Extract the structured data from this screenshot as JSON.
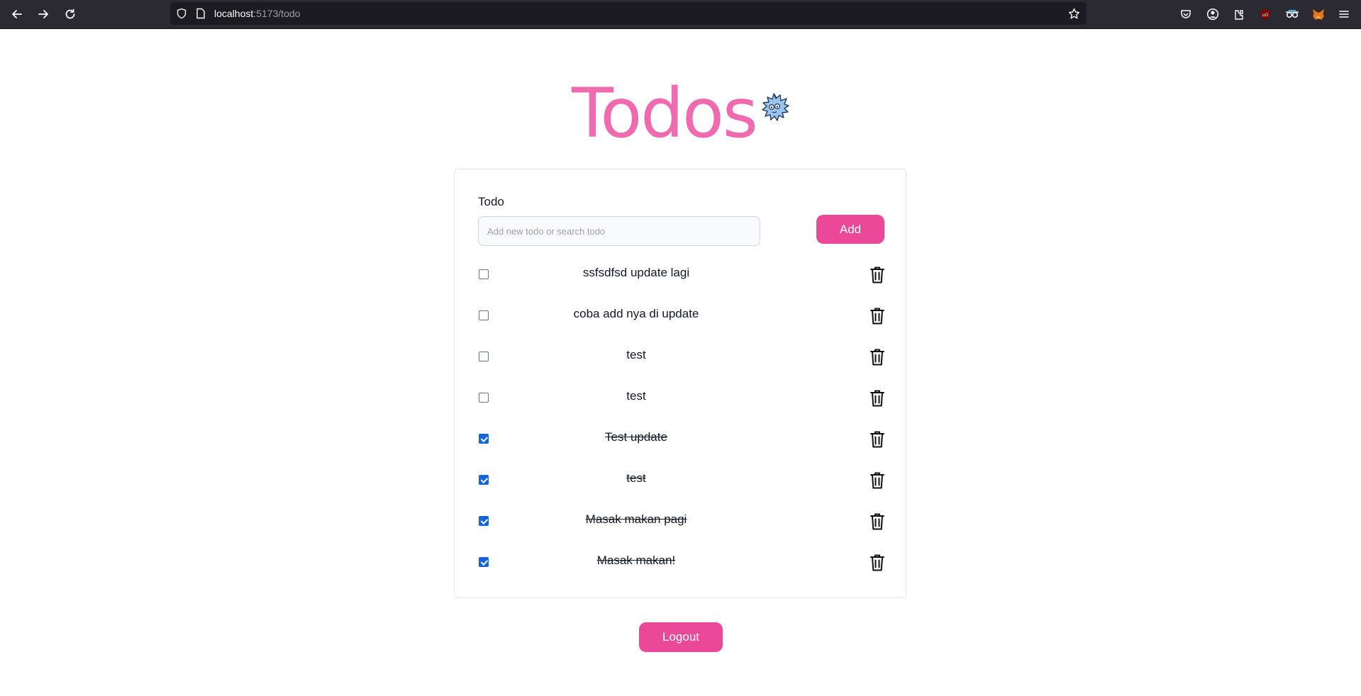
{
  "browser": {
    "url_host": "localhost",
    "url_path": ":5173/todo",
    "icons": [
      "back-icon",
      "forward-icon",
      "reload-icon",
      "shield-icon",
      "page-icon",
      "bookmark-star-icon",
      "pocket-icon",
      "account-icon",
      "extensions-icon",
      "ublock-icon",
      "privacy-icon",
      "metamask-icon",
      "menu-icon"
    ]
  },
  "page": {
    "title": "Todos",
    "mascot": "mascot-icon"
  },
  "form": {
    "label": "Todo",
    "placeholder": "Add new todo or search todo",
    "value": "",
    "add_label": "Add"
  },
  "todos": [
    {
      "text": "ssfsdfsd update lagi",
      "done": false
    },
    {
      "text": "coba add nya di update",
      "done": false
    },
    {
      "text": "test",
      "done": false
    },
    {
      "text": "test",
      "done": false
    },
    {
      "text": "Test update",
      "done": true
    },
    {
      "text": "test",
      "done": true
    },
    {
      "text": "Masak makan pagi",
      "done": true
    },
    {
      "text": "Masak makan!",
      "done": true
    }
  ],
  "logout_label": "Logout",
  "colors": {
    "accent": "#ec4899",
    "title": "#f06aaf",
    "checkbox_checked": "#1565d8",
    "chrome_bg": "#2b2a33"
  }
}
